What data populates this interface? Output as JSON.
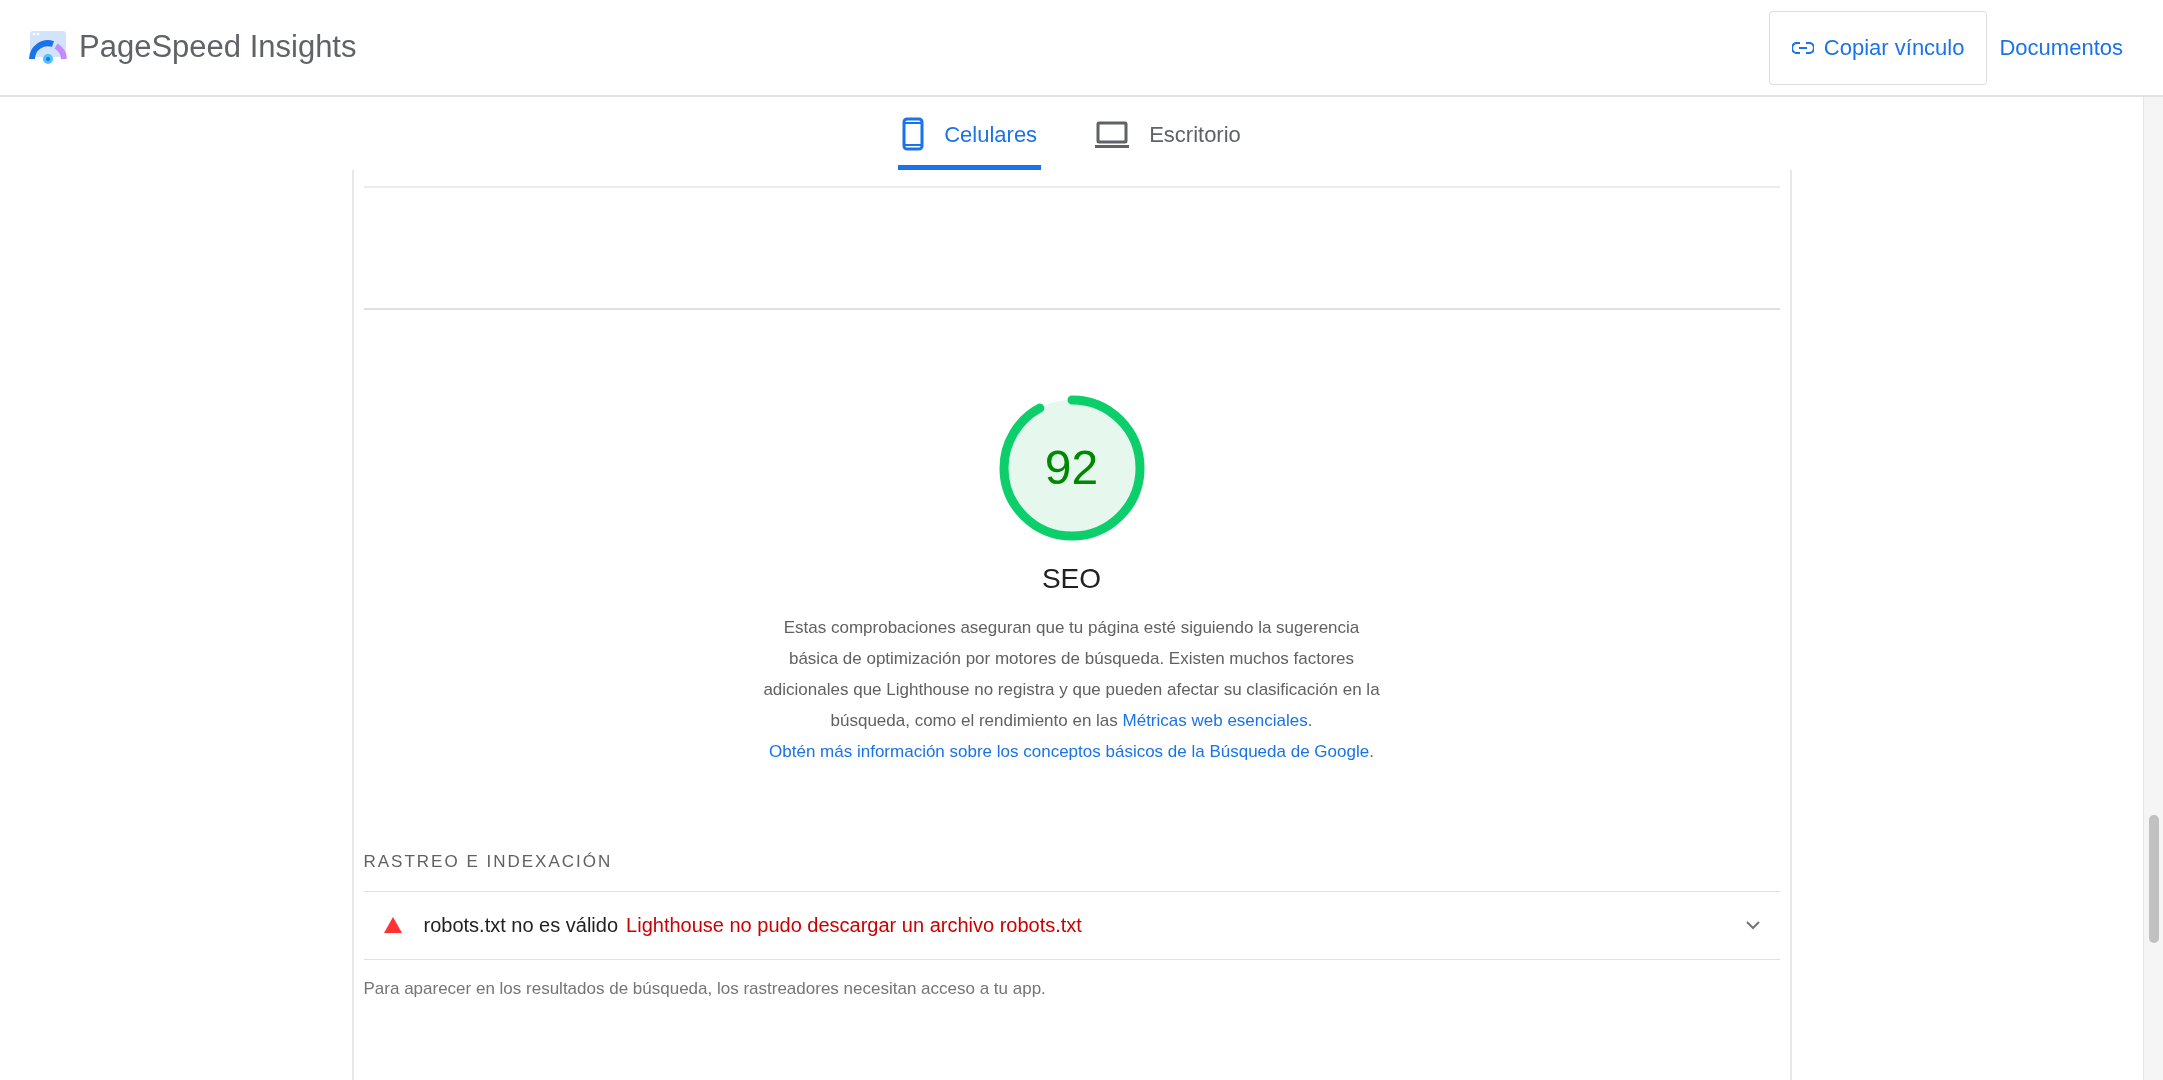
{
  "header": {
    "title": "PageSpeed Insights",
    "copy_button": "Copiar vínculo",
    "docs_link": "Documentos"
  },
  "tabs": [
    {
      "label": "Celulares",
      "kind": "phone",
      "selected": true
    },
    {
      "label": "Escritorio",
      "kind": "laptop",
      "selected": false
    }
  ],
  "score": {
    "value": "92",
    "level": 0.92,
    "title": "SEO"
  },
  "description": [
    {
      "kind": "text",
      "text": "Estas comprobaciones aseguran que tu página esté siguiendo la sugerencia básica de optimización por motores de búsqueda. Existen muchos factores adicionales que Lighthouse no registra y que pueden afectar su clasificación en la búsqueda, como el rendimiento en las "
    },
    {
      "kind": "link",
      "text": "Métricas web esenciales"
    },
    {
      "kind": "text",
      "text": ". "
    },
    {
      "kind": "link",
      "text": "Obtén más información sobre los conceptos básicos de la Búsqueda de Google"
    },
    {
      "kind": "text",
      "text": "."
    }
  ],
  "section": {
    "title": "RASTREO E INDEXACIÓN",
    "audits": [
      {
        "title": "robots.txt no es válido",
        "detail": "Lighthouse no pudo descargar un archivo robots.txt",
        "kind": "fail",
        "expanded": false
      }
    ],
    "note": "Para aparecer en los resultados de búsqueda, los rastreadores necesitan acceso a tu app."
  }
}
